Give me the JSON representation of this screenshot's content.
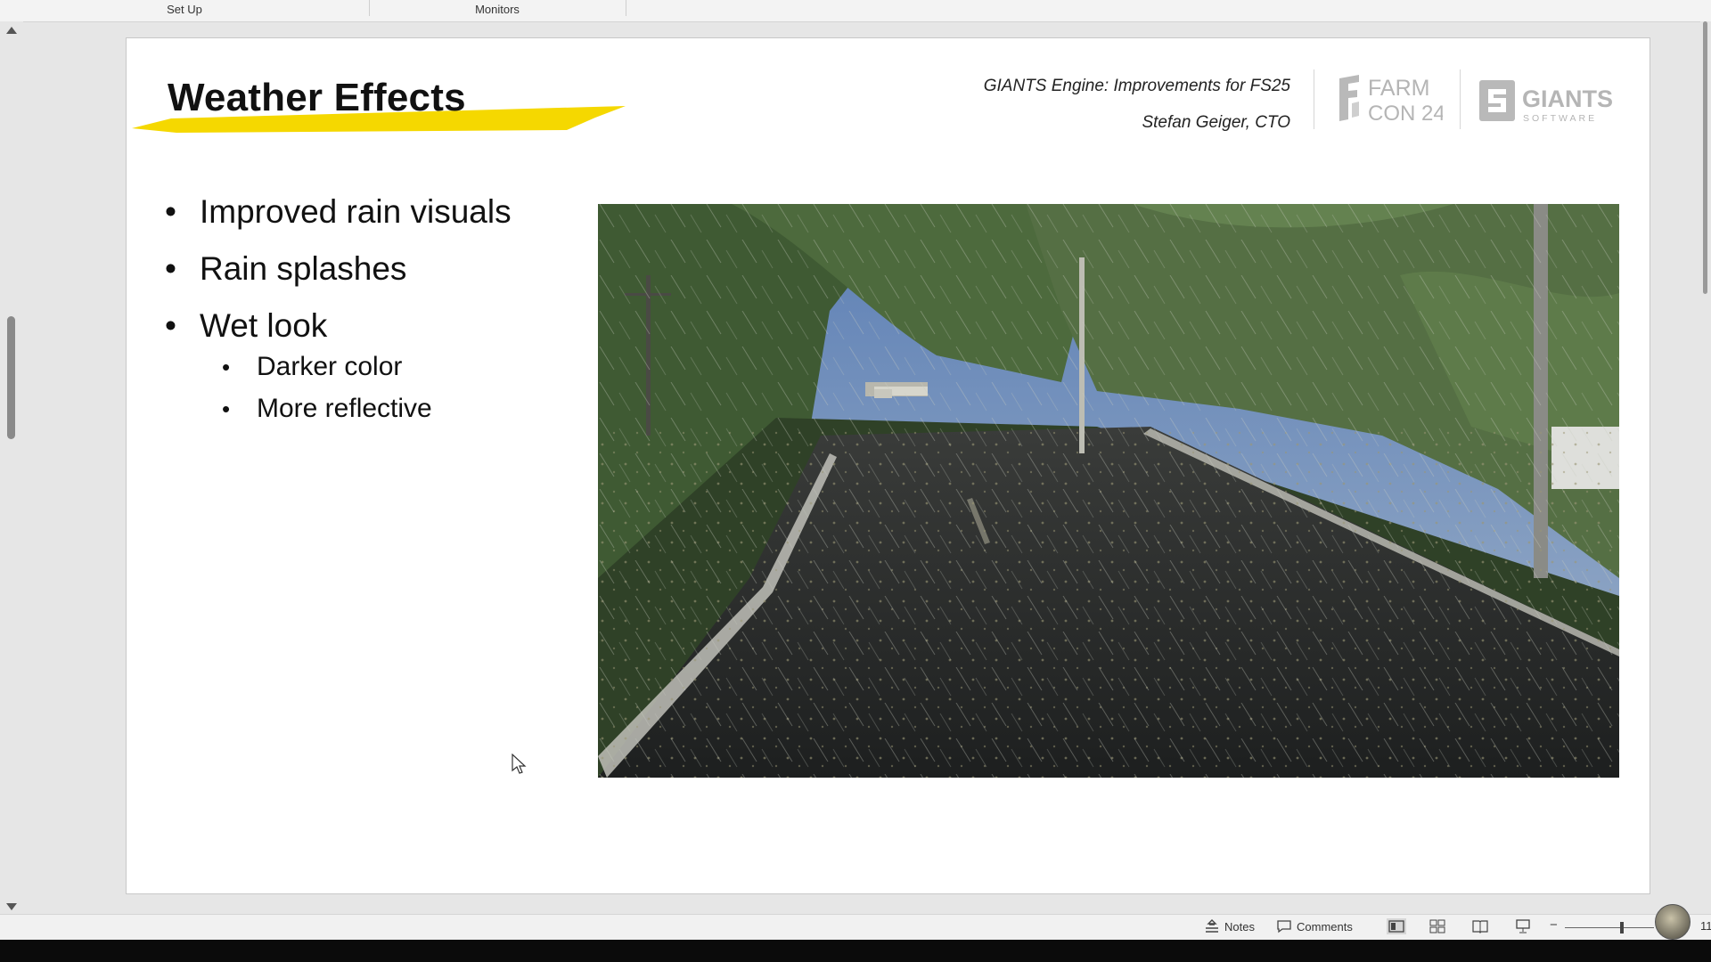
{
  "ribbon": {
    "groups": [
      "Set Up",
      "Monitors"
    ]
  },
  "slide": {
    "title": "Weather Effects",
    "subtitle_line1": "GIANTS Engine: Improvements for FS25",
    "subtitle_line2": "Stefan Geiger, CTO",
    "logos": {
      "farmcon": {
        "line1": "FARM",
        "line2": "CON 24"
      },
      "giants": {
        "line1": "GIANTS",
        "line2": "SOFTWARE"
      }
    },
    "bullets": [
      {
        "text": "Improved rain visuals"
      },
      {
        "text": "Rain splashes"
      },
      {
        "text": "Wet look"
      }
    ],
    "sub_bullets": [
      {
        "text": "Darker color"
      },
      {
        "text": "More reflective"
      }
    ],
    "image": {
      "description_icon": "rainy-road-screenshot"
    },
    "accent_color": "#f5d800"
  },
  "statusbar": {
    "notes_label": "Notes",
    "comments_label": "Comments",
    "zoom_partial": "11"
  }
}
